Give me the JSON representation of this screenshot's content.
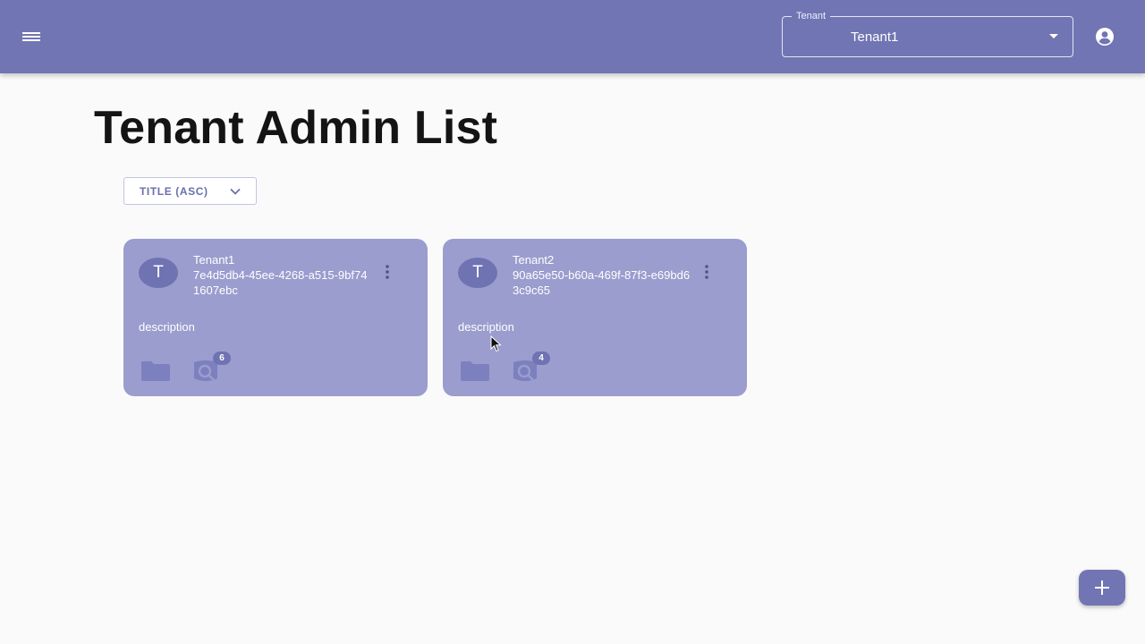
{
  "appbar": {
    "menu_icon": "hamburger-menu-icon",
    "tenant_select": {
      "label": "Tenant",
      "value": "Tenant1"
    },
    "account_icon": "account-circle-icon",
    "color": "#7175b3"
  },
  "page": {
    "title": "Tenant Admin List",
    "sort_button": "TITLE (ASC)"
  },
  "cards": [
    {
      "avatar": "T",
      "name": "Tenant1",
      "id": "7e4d5db4-45ee-4268-a515-9bf741607ebc",
      "description": "description",
      "badge": "6"
    },
    {
      "avatar": "T",
      "name": "Tenant2",
      "id": "90a65e50-b60a-469f-87f3-e69bd63c9c65",
      "description": "description",
      "badge": "4"
    }
  ],
  "fab": {
    "icon": "plus-icon"
  }
}
